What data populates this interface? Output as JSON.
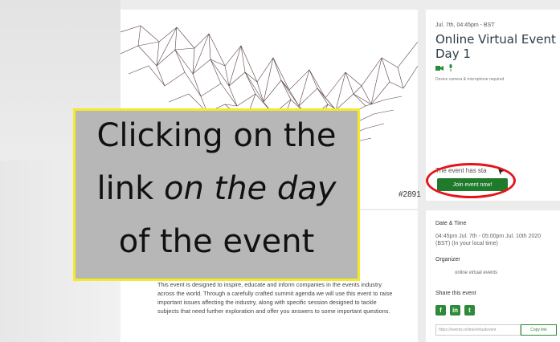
{
  "event": {
    "date_line": "Jul. 7th, 04:45pm - BST",
    "title": "Online Virtual Event Day 1",
    "requirements": "Device camera & microphone required",
    "status_text": "The event has sta",
    "join_label": "Join event now!",
    "event_id": "#2891"
  },
  "details": {
    "date_time_label": "Date & Time",
    "date_time_value": "04:45pm Jul. 7th - 05:00pm Jul. 10th 2020 (BST) (In your local time)",
    "organizer_label": "Organizer",
    "organizer_value": "online virtual events",
    "share_label": "Share this event",
    "share_link": "https://events.online/virtualevent",
    "copy_label": "Copy link",
    "social": [
      "f",
      "in",
      "t"
    ]
  },
  "description": "This event is designed to inspire, educate and inform companies in the events industry across the world. Through a carefully crafted summit agenda we will use this event to raise important issues affecting the industry, along with specific session designed to tackle subjects that need further exploration and offer you answers to some important questions.",
  "overlay": {
    "line1": "Clicking on the",
    "line2_before": "link ",
    "line2_italic": "on the day",
    "line3": "of the event"
  },
  "colors": {
    "accent": "#1f7a2c",
    "highlight_ring": "#e5141b",
    "overlay_border": "#f4ea2a",
    "overlay_bg": "#b7b7b7"
  },
  "icons": [
    "video-camera-icon",
    "microphone-icon",
    "cursor-icon"
  ]
}
